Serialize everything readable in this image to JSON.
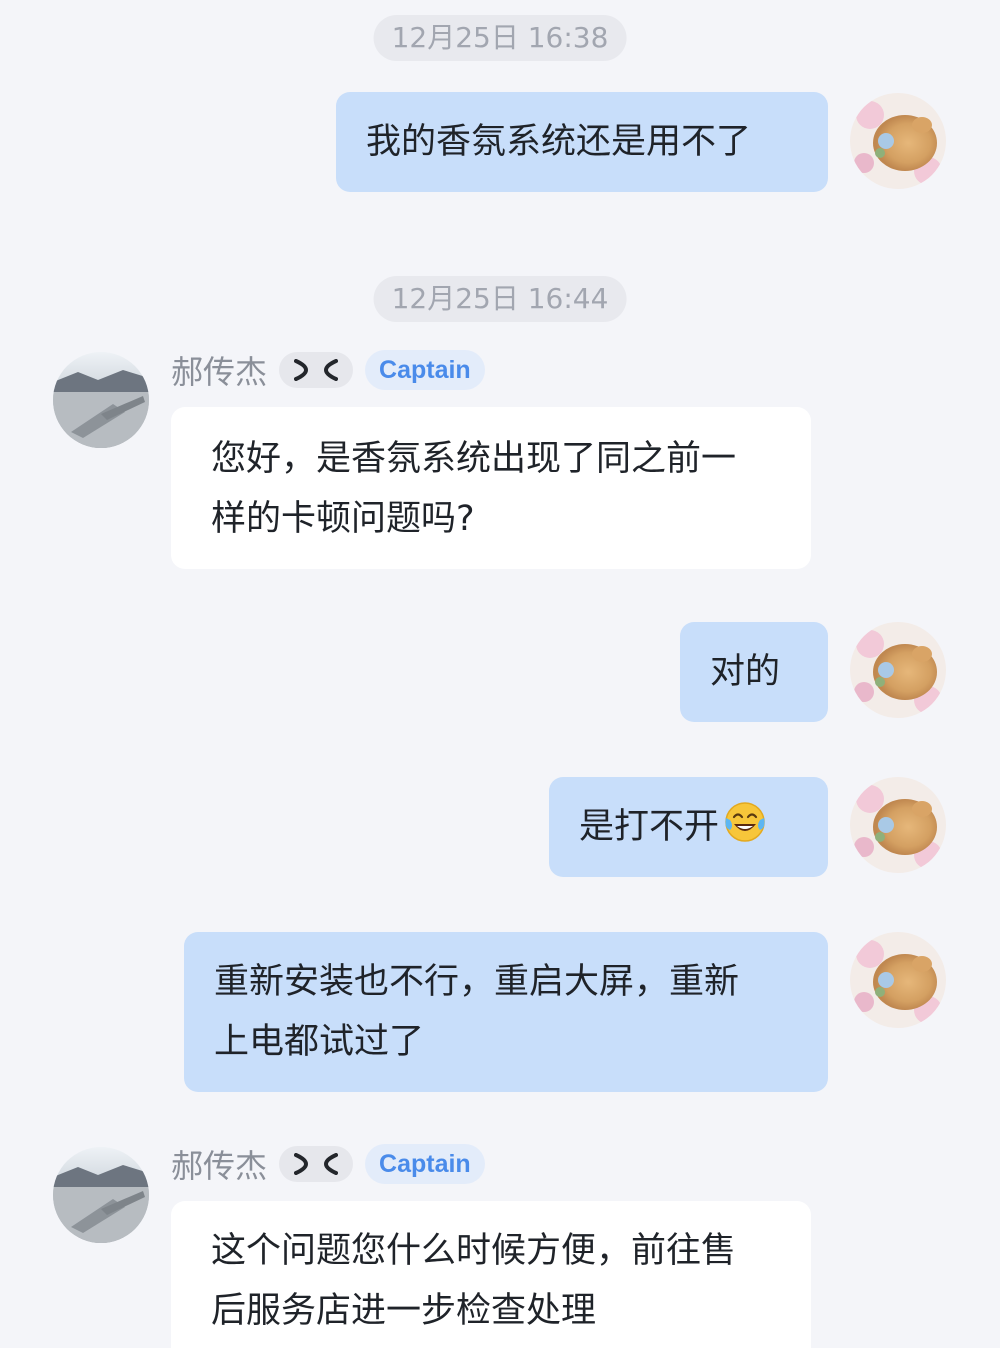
{
  "timestamps": [
    "12月25日 16:38",
    "12月25日 16:44"
  ],
  "agent": {
    "name": "郝传杰",
    "role": "Captain"
  },
  "messages": [
    {
      "direction": "out",
      "text": "我的香氛系统还是用不了"
    },
    {
      "direction": "in",
      "line1": "您好，是香氛系统出现了同之前一",
      "line2": "样的卡顿问题吗?"
    },
    {
      "direction": "out",
      "text": "对的"
    },
    {
      "direction": "out",
      "text": "是打不开",
      "emoji": "tears-of-joy"
    },
    {
      "direction": "out",
      "line1": "重新安装也不行，重启大屏，重新",
      "line2": "上电都试过了"
    },
    {
      "direction": "in",
      "line1": "这个问题您什么时候方便，前往售",
      "line2": "后服务店进一步检查处理"
    }
  ],
  "colors": {
    "background": "#f4f5f9",
    "outgoing_bubble": "#c8defa",
    "incoming_bubble": "#ffffff",
    "role_badge_text": "#4a8bea"
  }
}
